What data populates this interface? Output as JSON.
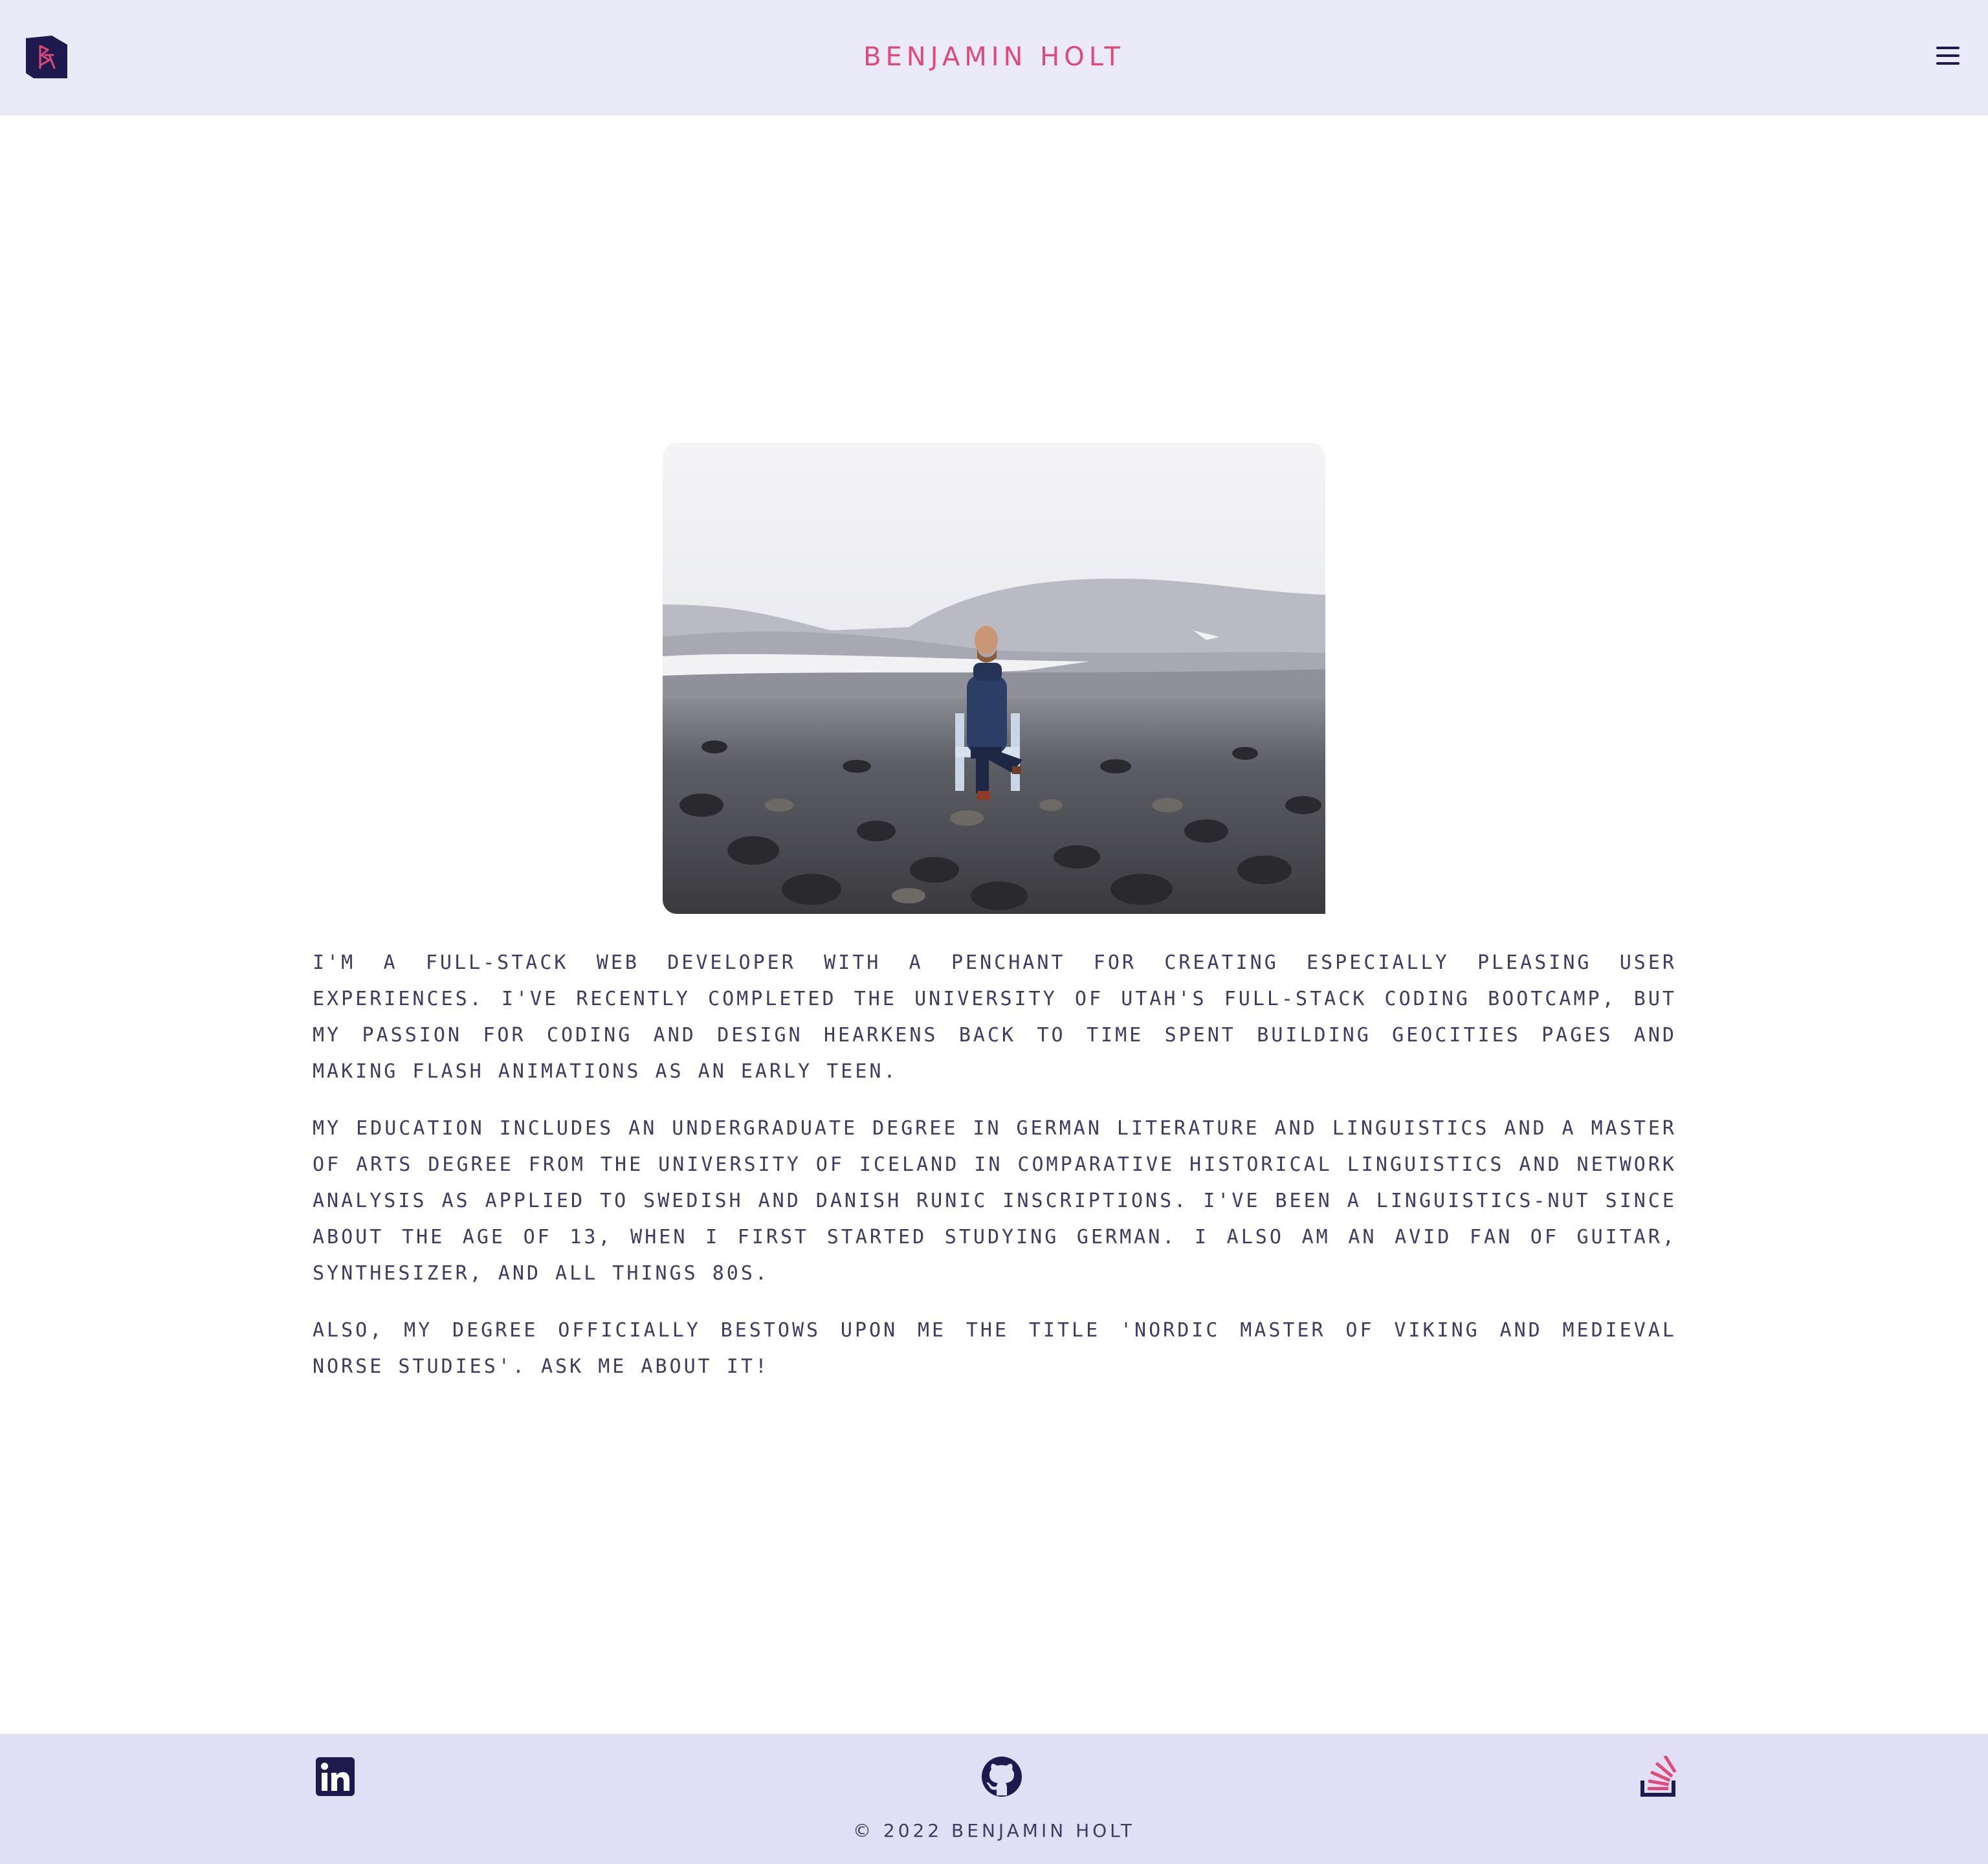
{
  "header": {
    "title": "BENJAMIN HOLT",
    "logo_icon": "bh-monogram-icon",
    "menu_icon": "hamburger-menu-icon"
  },
  "main": {
    "photo_icon": "portrait-photo-landscape",
    "paragraphs": [
      "I'm a full-stack web developer with a penchant for creating especially pleasing user experiences. I've recently completed the University of Utah's full-stack coding bootcamp, but my passion for coding and design hearkens back to time spent building GeoCities pages and making Flash animations as an early teen.",
      "My education includes an undergraduate degree in German literature and linguistics and a Master of Arts degree from the University of Iceland in comparative historical linguistics and network analysis as applied to Swedish and Danish runic inscriptions. I've been a linguistics-nut since about the age of 13, when I first started studying German. I also am an avid fan of guitar, synthesizer, and all things 80s.",
      "Also, my degree officially bestows upon me the title 'Nordic Master of Viking and Medieval Norse Studies'. Ask me about it!"
    ]
  },
  "footer": {
    "social": [
      {
        "name": "linkedin",
        "icon": "linkedin-icon"
      },
      {
        "name": "github",
        "icon": "github-icon"
      },
      {
        "name": "stackoverflow",
        "icon": "stackoverflow-icon"
      }
    ],
    "copyright": "© 2022 BENJAMIN HOLT"
  },
  "colors": {
    "accent": "#de4a7a",
    "brand_dark": "#1f1a4e",
    "header_bg": "#ebeaf8",
    "footer_bg": "#e0dff6",
    "text": "#3f3b63"
  }
}
